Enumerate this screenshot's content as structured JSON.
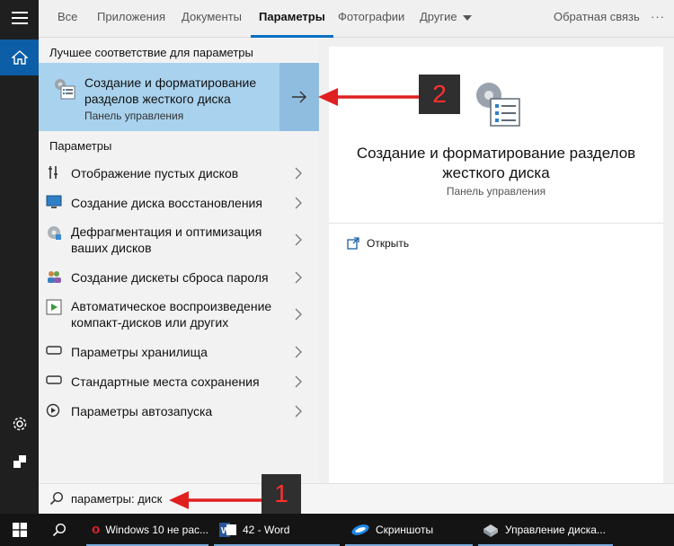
{
  "tabs": [
    {
      "label": "Все"
    },
    {
      "label": "Приложения"
    },
    {
      "label": "Документы"
    },
    {
      "label": "Параметры"
    },
    {
      "label": "Фотографии"
    },
    {
      "label": "Другие"
    }
  ],
  "active_tab": "Параметры",
  "feedback_label": "Обратная связь",
  "more_label": "···",
  "results": {
    "best_heading": "Лучшее соответствие для параметры",
    "best": {
      "title": "Создание и форматирование разделов жесткого диска",
      "subtitle": "Панель управления"
    },
    "params_heading": "Параметры",
    "items": [
      {
        "label": "Отображение пустых дисков",
        "icon": "wrench-icon"
      },
      {
        "label": "Создание диска восстановления",
        "icon": "monitor-icon"
      },
      {
        "label": "Дефрагментация и оптимизация ваших дисков",
        "icon": "defrag-icon"
      },
      {
        "label": "Создание дискеты сброса пароля",
        "icon": "users-icon"
      },
      {
        "label": "Автоматическое воспроизведение компакт-дисков или других",
        "icon": "autoplay-icon"
      },
      {
        "label": "Параметры хранилища",
        "icon": "storage-icon"
      },
      {
        "label": "Стандартные места сохранения",
        "icon": "storage-icon"
      },
      {
        "label": "Параметры автозапуска",
        "icon": "autostart-icon"
      }
    ]
  },
  "preview": {
    "title": "Создание и форматирование разделов жесткого диска",
    "subtitle": "Панель управления",
    "open_label": "Открыть"
  },
  "search": {
    "value": "параметры: диск"
  },
  "taskbar": [
    {
      "label": "Windows 10 не рас...",
      "icon": "opera-icon"
    },
    {
      "label": "42 - Word",
      "icon": "word-icon"
    },
    {
      "label": "Скриншоты",
      "icon": "screenshots-icon"
    },
    {
      "label": "Управление диска...",
      "icon": "disk-management-icon"
    }
  ],
  "annotations": {
    "badge1": "1",
    "badge2": "2"
  },
  "colors": {
    "accent": "#0a6fc2",
    "highlight": "#a9d2ee",
    "annotation": "#e02020"
  }
}
